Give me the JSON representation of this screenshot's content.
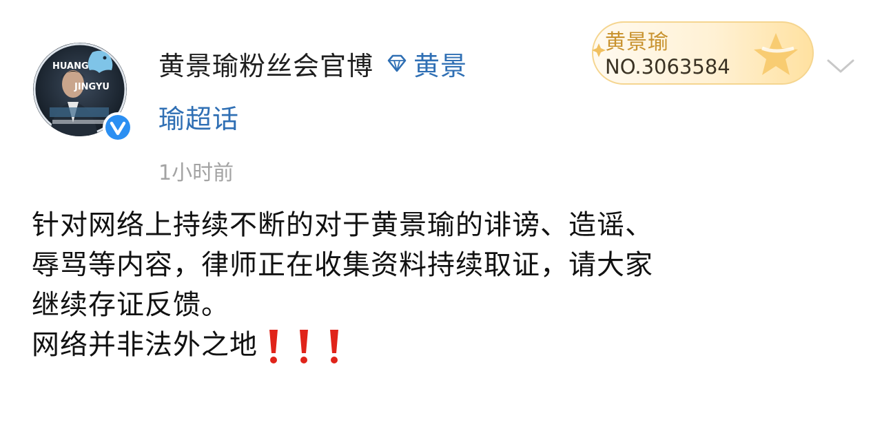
{
  "post": {
    "author": "黄景瑜粉丝会官博",
    "topic_part1": "黄景",
    "topic_part2": "瑜超话",
    "time": "1小时前",
    "badge": {
      "name": "黄景瑜",
      "number": "NO.3063584"
    },
    "avatar_text": {
      "line1": "HUANG",
      "line2": "JINGYU"
    },
    "content": {
      "line1": "针对网络上持续不断的对于黄景瑜的诽谤、造谣、",
      "line2": "辱骂等内容，律师正在收集资料持续取证，请大家",
      "line3": "继续存证反馈。",
      "line4": "网络并非法外之地"
    }
  },
  "colors": {
    "topic_blue": "#2f6fb4",
    "badge_gold": "#c8922e",
    "verified_blue": "#2b8ff2",
    "exclaim_red": "#e0241a"
  },
  "icons": {
    "verified": "verified-v-icon",
    "super_topic": "diamond-icon",
    "more": "chevron-down-icon",
    "exclaim": "red-exclamation-icon"
  }
}
